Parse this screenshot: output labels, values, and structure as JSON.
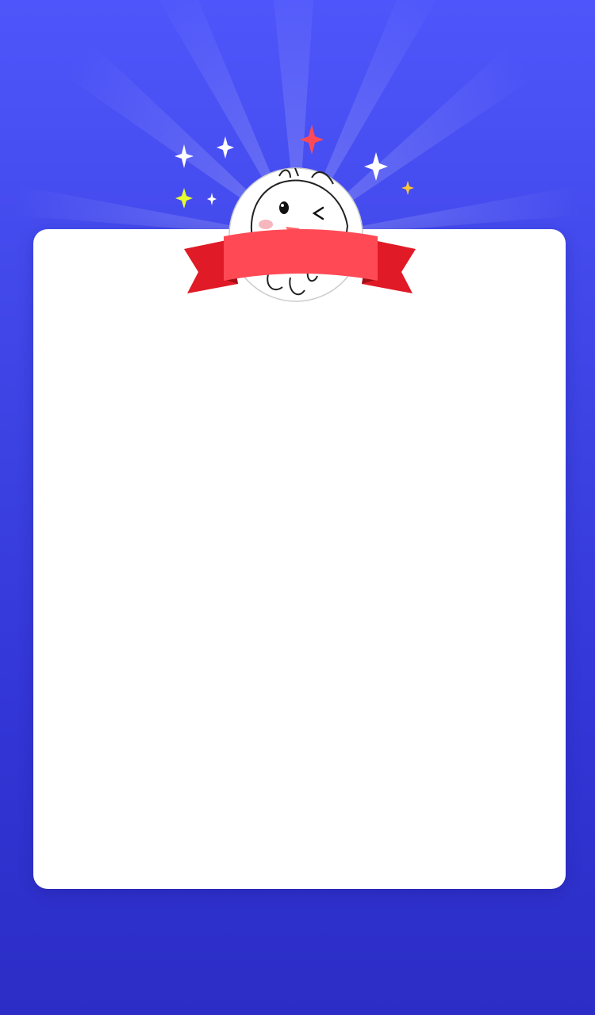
{
  "header": {
    "mascot_icon": "winking-mascot-icon",
    "ribbon_icon": "red-ribbon-banner-icon",
    "sparkle_icon": "sparkle-star-icon"
  },
  "card": {
    "title": ""
  },
  "colors": {
    "background_top": "#4e56fb",
    "background_bottom": "#2c2dc6",
    "ribbon": "#ff4a55",
    "ribbon_dark": "#d9131f",
    "card": "#ffffff"
  }
}
